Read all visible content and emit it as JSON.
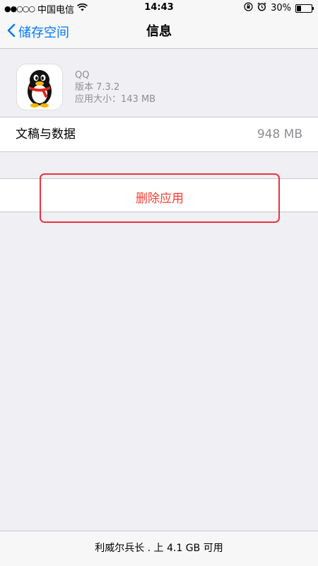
{
  "status_bar": {
    "signal": "●●○○○",
    "carrier": "中国电信",
    "time": "14:43",
    "battery_text": "30%",
    "battery_level": 0.3
  },
  "nav": {
    "back_label": "储存空间",
    "title": "信息"
  },
  "app": {
    "name": "QQ",
    "version": "版本 7.3.2",
    "size": "应用大小：143 MB",
    "icon": "qq-penguin-icon"
  },
  "documents": {
    "label": "文稿与数据",
    "value": "948 MB"
  },
  "delete": {
    "label": "删除应用"
  },
  "footer": {
    "text": "利威尔兵长 . 上 4.1 GB 可用"
  },
  "colors": {
    "accent": "#007aff",
    "destructive": "#ff3b30",
    "highlight_box": "#e8343f",
    "background": "#efeff4"
  }
}
